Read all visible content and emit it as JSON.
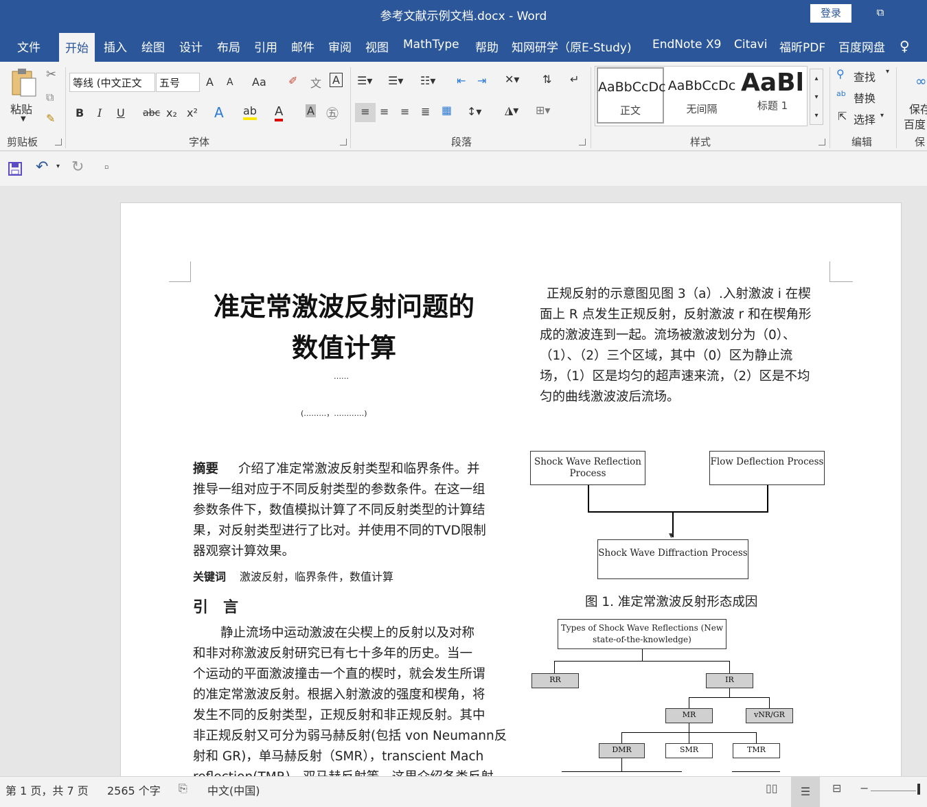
{
  "window": {
    "title": "参考文献示例文档.docx  -  Word",
    "login": "登录",
    "restore_icon": "⧉"
  },
  "tabs": [
    "文件",
    "开始",
    "插入",
    "绘图",
    "设计",
    "布局",
    "引用",
    "邮件",
    "审阅",
    "视图",
    "MathType",
    "帮助",
    "知网研学（原E-Study)",
    "EndNote X9",
    "Citavi",
    "福昕PDF",
    "百度网盘"
  ],
  "ribbon": {
    "clipboard": {
      "paste": "粘贴",
      "label": "剪贴板"
    },
    "font": {
      "family": "等线 (中文正文",
      "size": "五号",
      "grow": "A",
      "shrink": "A",
      "case": "Aa",
      "bold": "B",
      "italic": "I",
      "underline": "U",
      "strike": "abc",
      "subscript": "x₂",
      "superscript": "x²",
      "label": "字体"
    },
    "paragraph": {
      "label": "段落"
    },
    "styles": {
      "cards": [
        {
          "preview": "AaBbCcDc",
          "name": "正文"
        },
        {
          "preview": "AaBbCcDc",
          "name": "无间隔"
        },
        {
          "preview": "AaBl",
          "name": "标题 1"
        }
      ],
      "label": "样式"
    },
    "editing": {
      "find": "查找",
      "replace": "替换",
      "select": "选择",
      "label": "编辑"
    },
    "save": {
      "line1": "保存",
      "line2": "百度",
      "label": "保"
    }
  },
  "document": {
    "title_line1": "准定常激波反射问题的",
    "title_line2": "数值计算",
    "author": "……",
    "affiliation": "(………，…………)",
    "abstract_label": "摘要",
    "abstract_lines": [
      "介绍了准定常激波反射类型和临界条件。并",
      "推导一组对应于不同反射类型的参数条件。在这一组",
      "参数条件下，数值模拟计算了不同反射类型的计算结",
      "果，对反射类型进行了比对。并使用不同的TVD限制",
      "器观察计算效果。"
    ],
    "keywords_label": "关键词",
    "keywords": "激波反射，临界条件，数值计算",
    "intro_heading": "引　言",
    "intro_lines": [
      "静止流场中运动激波在尖楔上的反射以及对称",
      "和非对称激波反射研究已有七十多年的历史。当一",
      "个运动的平面激波撞击一个直的楔时，就会发生所谓",
      "的准定常激波反射。根据入射激波的强度和楔角，将",
      "发生不同的反射类型，正规反射和非正规反射。其中",
      "非正规反射又可分为弱马赫反射(包括 von Neumann反",
      "射和 GR)，单马赫反射（SMR），transcient  Mach",
      "reflection(TMR)，双马赫反射等。这里介绍各类反射"
    ],
    "right_lines": [
      "正规反射的示意图见图 3（a）.入射激波 i 在楔",
      "面上 R 点发生正规反射，反射激波 r 和在楔角形",
      "成的激波连到一起。流场被激波划分为（0）、",
      "（1）、（2）三个区域，其中（0）区为静止流",
      "场，（1）区是均匀的超声速来流，（2）区是不均",
      "匀的曲线激波波后流场。"
    ],
    "fig1": {
      "box1": "Shock Wave Reflection Process",
      "box2": "Flow Deflection Process",
      "box3": "Shock Wave Diffraction Process",
      "caption": "图 1. 准定常激波反射形态成因"
    },
    "fig2": {
      "root": "Types of Shock Wave Reflections (New state-of-the-knowledge)",
      "rr": "RR",
      "ir": "IR",
      "mr": "MR",
      "vnr": "vNR/GR",
      "dmr": "DMR",
      "smr": "SMR",
      "tmr": "TMR"
    }
  },
  "status": {
    "page": "第 1 页，共 7 页",
    "words": "2565 个字",
    "lang": "中文(中国)"
  }
}
